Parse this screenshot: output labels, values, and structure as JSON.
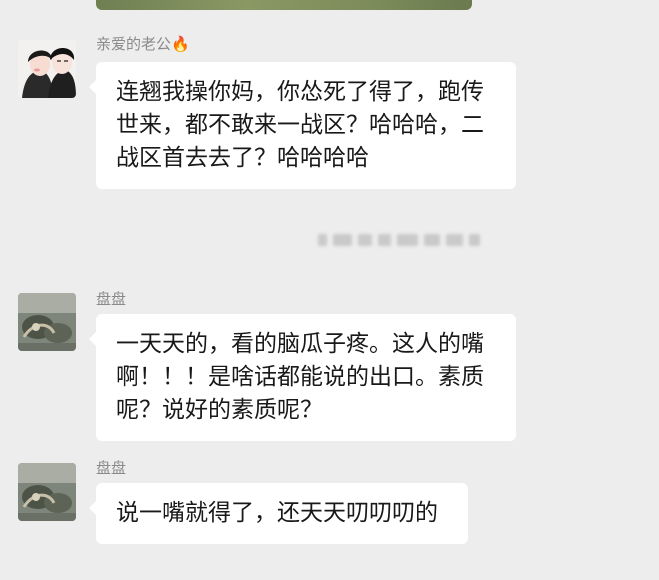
{
  "messages": [
    {
      "sender": "亲爱的老公",
      "sender_emoji": "🔥",
      "lines": [
        "连翘我操你妈，你怂死了得了，跑传",
        "世来，都不敢来一战区？哈哈哈，二",
        "战区首去去了？哈哈哈哈"
      ]
    },
    {
      "sender": "盘盘",
      "lines": [
        "一天天的，看的脑瓜子疼。这人的嘴",
        "啊！！！是啥话都能说的出口。素质",
        "呢？说好的素质呢？"
      ]
    },
    {
      "sender": "盘盘",
      "lines": [
        "说一嘴就得了，还天天叨叨叨的"
      ]
    }
  ],
  "icons": {
    "fire": "fire-emoji"
  },
  "colors": {
    "background": "#ededed",
    "bubble": "#ffffff",
    "name": "#8a8a8a",
    "text": "#191919"
  }
}
